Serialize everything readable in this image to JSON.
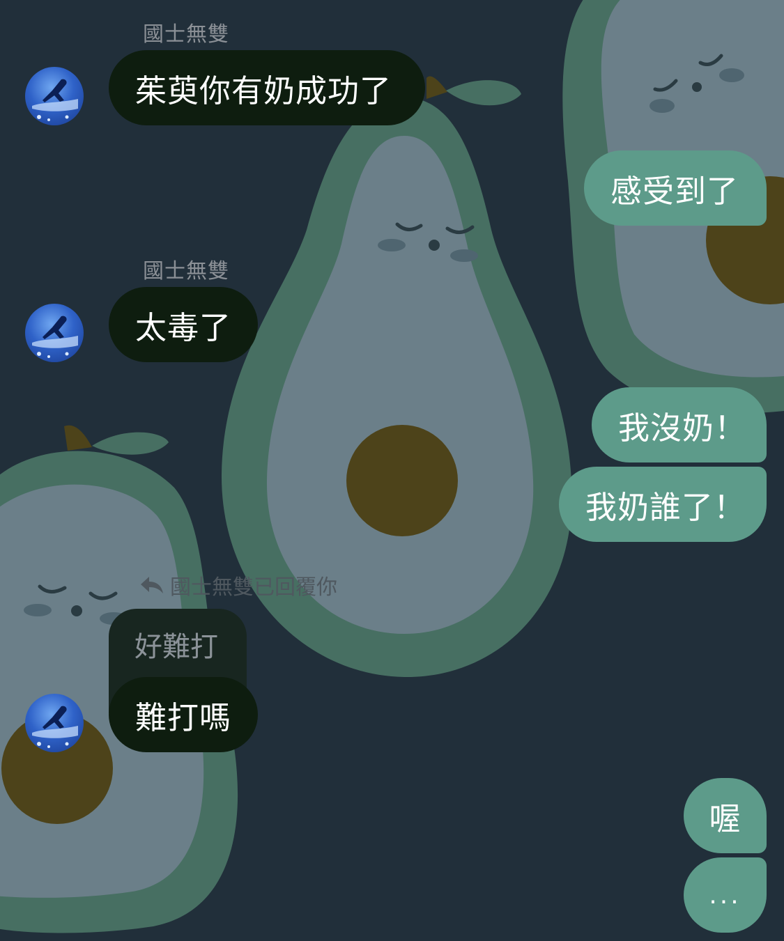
{
  "chat": {
    "messages": [
      {
        "direction": "incoming",
        "sender": "國士無雙",
        "text": "茱萸你有奶成功了"
      },
      {
        "direction": "outgoing",
        "text": "感受到了"
      },
      {
        "direction": "incoming",
        "sender": "國士無雙",
        "text": "太毒了"
      },
      {
        "direction": "outgoing",
        "text": "我沒奶！"
      },
      {
        "direction": "outgoing",
        "text": "我奶誰了！"
      },
      {
        "direction": "incoming",
        "reply_note": "國士無雙已回覆你",
        "quoted_text": "好難打",
        "text": "難打嗎"
      },
      {
        "direction": "outgoing",
        "text": "喔"
      },
      {
        "direction": "outgoing",
        "text": "..."
      }
    ]
  },
  "colors": {
    "background": "#212f3a",
    "incoming_bubble": "#0e1d0f",
    "outgoing_bubble": "#5d9b8a",
    "avocado_skin": "#476f62",
    "avocado_flesh": "#6b7f89",
    "avocado_pit": "#4d431a"
  },
  "icons": {
    "avatar": "avatar-icon",
    "reply": "reply-arrow-icon",
    "background": "avocado-wallpaper"
  }
}
